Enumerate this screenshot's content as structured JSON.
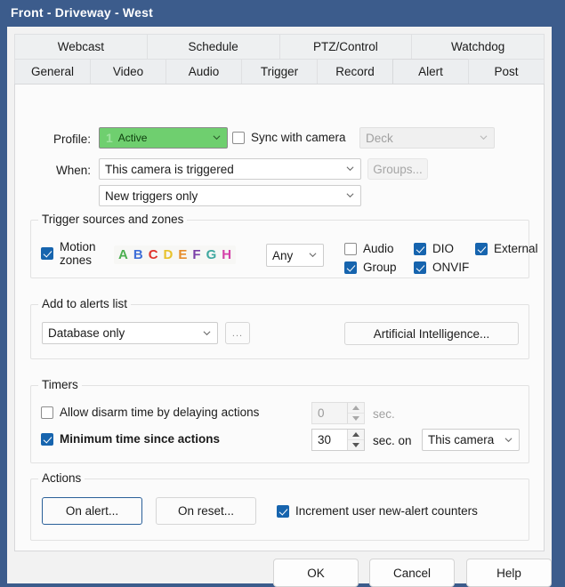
{
  "window": {
    "title": "Front - Driveway - West",
    "titlebar_color": "#3c5c8c"
  },
  "tabs": {
    "row1": [
      {
        "label": "Webcast",
        "selected": false
      },
      {
        "label": "Schedule",
        "selected": false
      },
      {
        "label": "PTZ/Control",
        "selected": false
      },
      {
        "label": "Watchdog",
        "selected": false
      }
    ],
    "row2": [
      {
        "label": "General",
        "selected": false
      },
      {
        "label": "Video",
        "selected": false
      },
      {
        "label": "Audio",
        "selected": false
      },
      {
        "label": "Trigger",
        "selected": false
      },
      {
        "label": "Record",
        "selected": false
      },
      {
        "label": "Alert",
        "selected": true
      },
      {
        "label": "Post",
        "selected": false
      }
    ]
  },
  "profile": {
    "label": "Profile:",
    "value": "Active",
    "badge": "1",
    "accent_color": "#6fcf6f",
    "sync_checkbox": {
      "label": "Sync with camera",
      "checked": false
    },
    "deck": {
      "value": "Deck",
      "enabled": false
    }
  },
  "when": {
    "label": "When:",
    "condition": "This camera is triggered",
    "mode": "New triggers only",
    "groups_button": {
      "label": "Groups...",
      "enabled": false
    }
  },
  "trigger_sources": {
    "title": "Trigger sources and zones",
    "motion_zones": {
      "label_line1": "Motion",
      "label_line2": "zones",
      "checked": true
    },
    "zone_letters": [
      {
        "letter": "A",
        "color": "#4caf50"
      },
      {
        "letter": "B",
        "color": "#3f6fd8"
      },
      {
        "letter": "C",
        "color": "#e0332c"
      },
      {
        "letter": "D",
        "color": "#e8c22a"
      },
      {
        "letter": "E",
        "color": "#e78c2a"
      },
      {
        "letter": "F",
        "color": "#7b3fa8"
      },
      {
        "letter": "G",
        "color": "#3fa8a0"
      },
      {
        "letter": "H",
        "color": "#d43fa8"
      }
    ],
    "match": "Any",
    "checkboxes": [
      {
        "label": "Audio",
        "checked": false
      },
      {
        "label": "DIO",
        "checked": true
      },
      {
        "label": "External",
        "checked": true
      },
      {
        "label": "Group",
        "checked": true
      },
      {
        "label": "ONVIF",
        "checked": true
      }
    ]
  },
  "alerts_list": {
    "title": "Add to alerts list",
    "value": "Database only",
    "ellipsis_button": "...",
    "ai_button": "Artificial Intelligence..."
  },
  "timers": {
    "title": "Timers",
    "disarm": {
      "label": "Allow disarm time by delaying actions",
      "checked": false,
      "value": "0",
      "unit": "sec.",
      "enabled": false
    },
    "minimum": {
      "label": "Minimum time since actions",
      "checked": true,
      "value": "30",
      "unit": "sec. on",
      "scope": "This camera"
    }
  },
  "actions": {
    "title": "Actions",
    "on_alert_button": "On alert...",
    "on_reset_button": "On reset...",
    "increment_checkbox": {
      "label": "Increment user new-alert counters",
      "checked": true
    }
  },
  "footer": {
    "ok": "OK",
    "cancel": "Cancel",
    "help": "Help"
  }
}
